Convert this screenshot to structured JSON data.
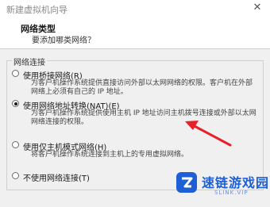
{
  "window": {
    "title": "新建虚拟机向导",
    "close_glyph": "✕"
  },
  "header": {
    "title": "网络类型",
    "subtitle": "要添加哪类网络？"
  },
  "network_group": {
    "legend": "网络连接",
    "options": [
      {
        "label": "使用桥接网络(R)",
        "description": "为客户机操作系统提供直接访问外部以太网网络的权限。客户机在外部网络上必须有自己的 IP 地址。",
        "selected": false
      },
      {
        "label": "使用网络地址转换(NAT)(E)",
        "description": "为客户机操作系统提供使用主机 IP 地址访问主机拨号连接或外部以太网网络连接的权限。",
        "selected": true
      },
      {
        "label": "使用仅主机模式网络(H)",
        "description": "将客户机操作系统连接到主机上的专用虚拟网络。",
        "selected": false
      },
      {
        "label": "不使用网络连接(T)",
        "description": "",
        "selected": false
      }
    ]
  },
  "watermark": {
    "text": "速链游戏园",
    "subtext": "SLINK.VIP"
  },
  "colors": {
    "arrow": "#e8202a",
    "watermark_blue": "#1e5fd6"
  },
  "icons": [
    "close-icon",
    "arrow-annotation-icon",
    "watermark-logo-icon"
  ]
}
